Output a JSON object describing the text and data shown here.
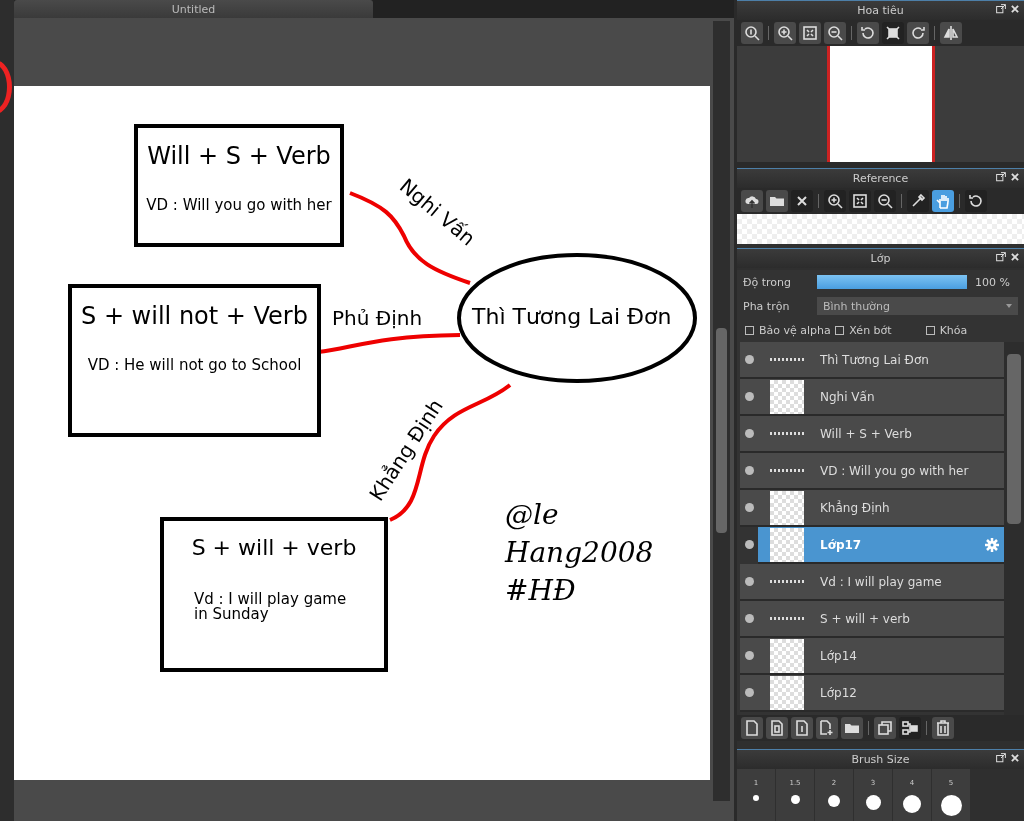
{
  "document_tab": {
    "title": "Untitled"
  },
  "canvas": {
    "boxes": [
      {
        "heading": "Will + S + Verb",
        "example": "VD : Will you go with her"
      },
      {
        "heading": "S + will not + Verb",
        "example": "VD : He will not go to School"
      },
      {
        "heading": "S + will + verb",
        "example": "Vd : I will play game in Sunday"
      }
    ],
    "center": "Thì Tương Lai Đơn",
    "branch_labels": [
      "Nghi Vấn",
      "Phủ Định",
      "Khẳng Định"
    ],
    "signature": [
      "@le",
      "Hang2008",
      "#HĐ"
    ]
  },
  "navigator": {
    "title": "Hoa tiêu"
  },
  "reference": {
    "title": "Reference",
    "tools": [
      {
        "selected": false
      },
      {
        "selected": false
      },
      {
        "selected": false
      },
      {
        "selected": false
      },
      {
        "selected": false
      },
      {
        "selected": false
      },
      {
        "selected": false
      },
      {
        "selected": true
      },
      {
        "selected": false
      }
    ]
  },
  "layers": {
    "title": "Lớp",
    "opacity_label": "Độ trong",
    "opacity": {
      "level": 1,
      "reading": "100 %"
    },
    "blend_label": "Pha trộn",
    "blend_value": "Bình thường",
    "options": [
      {
        "label": "Bảo vệ alpha",
        "checked": false
      },
      {
        "label": "Xén bớt",
        "checked": false
      },
      {
        "label": "Khóa",
        "checked": false
      }
    ],
    "items": [
      {
        "name": "Thì Tương Lai Đơn",
        "kind": "strip",
        "selected": false
      },
      {
        "name": "Nghi Vấn",
        "kind": "image",
        "selected": false
      },
      {
        "name": "Will + S + Verb",
        "kind": "strip",
        "selected": false
      },
      {
        "name": "VD : Will you go with her",
        "kind": "strip",
        "selected": false
      },
      {
        "name": "Khẳng Định",
        "kind": "image",
        "selected": false
      },
      {
        "name": "Lớp17",
        "kind": "image",
        "selected": true
      },
      {
        "name": "Vd : I will play game",
        "kind": "strip",
        "selected": false
      },
      {
        "name": "S + will + verb",
        "kind": "strip",
        "selected": false
      },
      {
        "name": "Lớp14",
        "kind": "image",
        "selected": false
      },
      {
        "name": "Lớp12",
        "kind": "image",
        "selected": false
      }
    ]
  },
  "brush_size": {
    "title": "Brush Size",
    "sizes": [
      "1",
      "1.5",
      "2",
      "3",
      "4",
      "5"
    ]
  }
}
